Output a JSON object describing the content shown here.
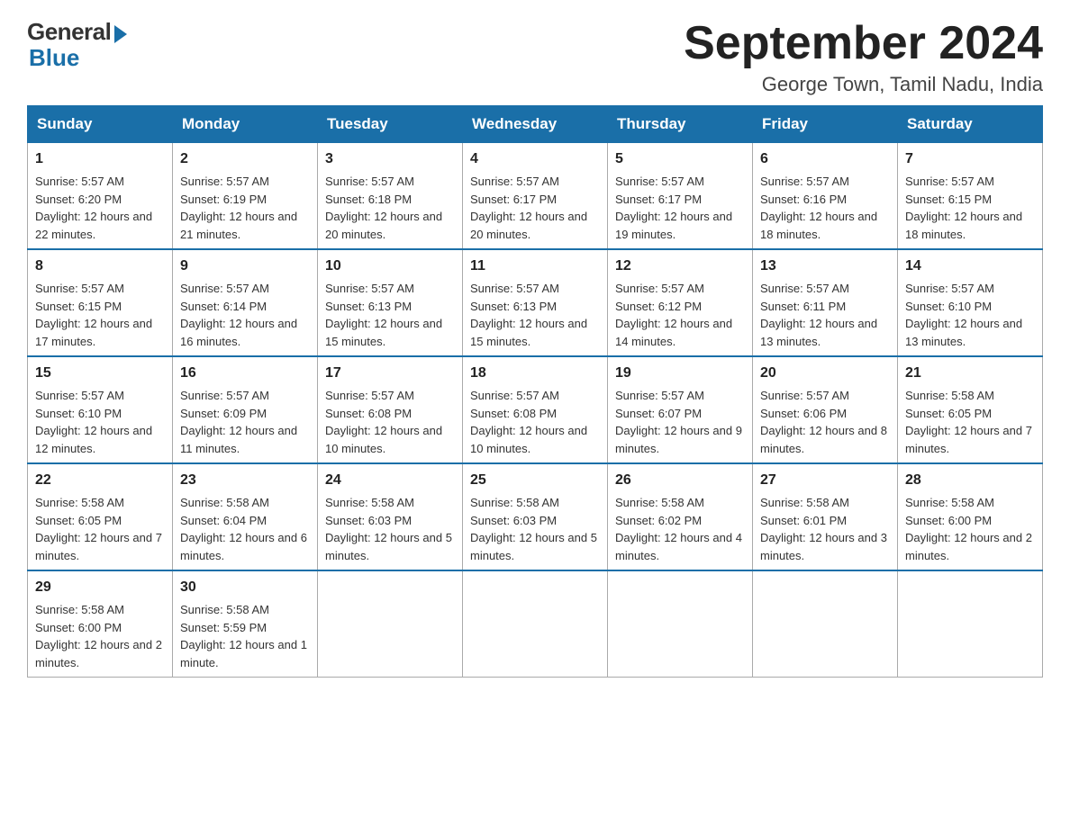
{
  "logo": {
    "general": "General",
    "blue": "Blue"
  },
  "title": "September 2024",
  "location": "George Town, Tamil Nadu, India",
  "weekdays": [
    "Sunday",
    "Monday",
    "Tuesday",
    "Wednesday",
    "Thursday",
    "Friday",
    "Saturday"
  ],
  "weeks": [
    [
      {
        "day": "1",
        "sunrise": "5:57 AM",
        "sunset": "6:20 PM",
        "daylight": "12 hours and 22 minutes."
      },
      {
        "day": "2",
        "sunrise": "5:57 AM",
        "sunset": "6:19 PM",
        "daylight": "12 hours and 21 minutes."
      },
      {
        "day": "3",
        "sunrise": "5:57 AM",
        "sunset": "6:18 PM",
        "daylight": "12 hours and 20 minutes."
      },
      {
        "day": "4",
        "sunrise": "5:57 AM",
        "sunset": "6:17 PM",
        "daylight": "12 hours and 20 minutes."
      },
      {
        "day": "5",
        "sunrise": "5:57 AM",
        "sunset": "6:17 PM",
        "daylight": "12 hours and 19 minutes."
      },
      {
        "day": "6",
        "sunrise": "5:57 AM",
        "sunset": "6:16 PM",
        "daylight": "12 hours and 18 minutes."
      },
      {
        "day": "7",
        "sunrise": "5:57 AM",
        "sunset": "6:15 PM",
        "daylight": "12 hours and 18 minutes."
      }
    ],
    [
      {
        "day": "8",
        "sunrise": "5:57 AM",
        "sunset": "6:15 PM",
        "daylight": "12 hours and 17 minutes."
      },
      {
        "day": "9",
        "sunrise": "5:57 AM",
        "sunset": "6:14 PM",
        "daylight": "12 hours and 16 minutes."
      },
      {
        "day": "10",
        "sunrise": "5:57 AM",
        "sunset": "6:13 PM",
        "daylight": "12 hours and 15 minutes."
      },
      {
        "day": "11",
        "sunrise": "5:57 AM",
        "sunset": "6:13 PM",
        "daylight": "12 hours and 15 minutes."
      },
      {
        "day": "12",
        "sunrise": "5:57 AM",
        "sunset": "6:12 PM",
        "daylight": "12 hours and 14 minutes."
      },
      {
        "day": "13",
        "sunrise": "5:57 AM",
        "sunset": "6:11 PM",
        "daylight": "12 hours and 13 minutes."
      },
      {
        "day": "14",
        "sunrise": "5:57 AM",
        "sunset": "6:10 PM",
        "daylight": "12 hours and 13 minutes."
      }
    ],
    [
      {
        "day": "15",
        "sunrise": "5:57 AM",
        "sunset": "6:10 PM",
        "daylight": "12 hours and 12 minutes."
      },
      {
        "day": "16",
        "sunrise": "5:57 AM",
        "sunset": "6:09 PM",
        "daylight": "12 hours and 11 minutes."
      },
      {
        "day": "17",
        "sunrise": "5:57 AM",
        "sunset": "6:08 PM",
        "daylight": "12 hours and 10 minutes."
      },
      {
        "day": "18",
        "sunrise": "5:57 AM",
        "sunset": "6:08 PM",
        "daylight": "12 hours and 10 minutes."
      },
      {
        "day": "19",
        "sunrise": "5:57 AM",
        "sunset": "6:07 PM",
        "daylight": "12 hours and 9 minutes."
      },
      {
        "day": "20",
        "sunrise": "5:57 AM",
        "sunset": "6:06 PM",
        "daylight": "12 hours and 8 minutes."
      },
      {
        "day": "21",
        "sunrise": "5:58 AM",
        "sunset": "6:05 PM",
        "daylight": "12 hours and 7 minutes."
      }
    ],
    [
      {
        "day": "22",
        "sunrise": "5:58 AM",
        "sunset": "6:05 PM",
        "daylight": "12 hours and 7 minutes."
      },
      {
        "day": "23",
        "sunrise": "5:58 AM",
        "sunset": "6:04 PM",
        "daylight": "12 hours and 6 minutes."
      },
      {
        "day": "24",
        "sunrise": "5:58 AM",
        "sunset": "6:03 PM",
        "daylight": "12 hours and 5 minutes."
      },
      {
        "day": "25",
        "sunrise": "5:58 AM",
        "sunset": "6:03 PM",
        "daylight": "12 hours and 5 minutes."
      },
      {
        "day": "26",
        "sunrise": "5:58 AM",
        "sunset": "6:02 PM",
        "daylight": "12 hours and 4 minutes."
      },
      {
        "day": "27",
        "sunrise": "5:58 AM",
        "sunset": "6:01 PM",
        "daylight": "12 hours and 3 minutes."
      },
      {
        "day": "28",
        "sunrise": "5:58 AM",
        "sunset": "6:00 PM",
        "daylight": "12 hours and 2 minutes."
      }
    ],
    [
      {
        "day": "29",
        "sunrise": "5:58 AM",
        "sunset": "6:00 PM",
        "daylight": "12 hours and 2 minutes."
      },
      {
        "day": "30",
        "sunrise": "5:58 AM",
        "sunset": "5:59 PM",
        "daylight": "12 hours and 1 minute."
      },
      null,
      null,
      null,
      null,
      null
    ]
  ],
  "labels": {
    "sunrise": "Sunrise:",
    "sunset": "Sunset:",
    "daylight": "Daylight:"
  }
}
